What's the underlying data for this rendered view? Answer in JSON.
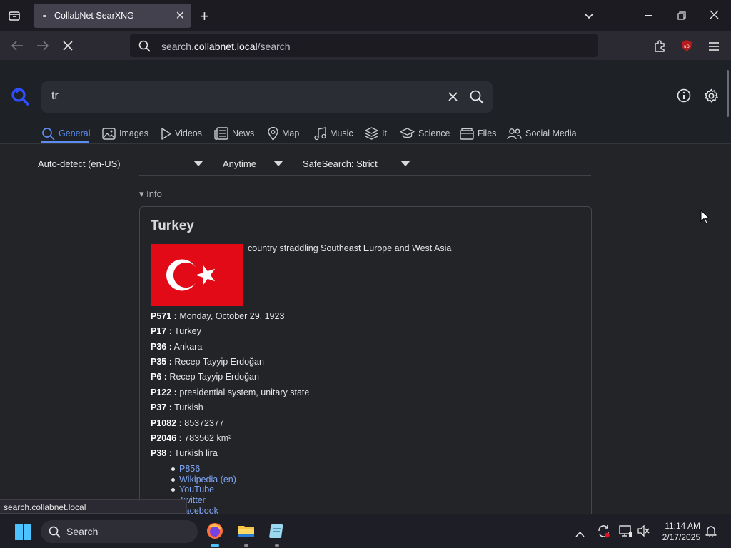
{
  "browser": {
    "tab_title": "CollabNet SearXNG",
    "url_prefix": "search.",
    "url_host": "collabnet.local",
    "url_path": "/search",
    "status_url": "search.collabnet.local"
  },
  "search": {
    "query": "tr"
  },
  "categories": [
    {
      "label": "General",
      "icon": "search-icon",
      "active": true
    },
    {
      "label": "Images",
      "icon": "image-icon"
    },
    {
      "label": "Videos",
      "icon": "play-icon"
    },
    {
      "label": "News",
      "icon": "newspaper-icon"
    },
    {
      "label": "Map",
      "icon": "map-pin-icon"
    },
    {
      "label": "Music",
      "icon": "music-note-icon"
    },
    {
      "label": "It",
      "icon": "layers-icon"
    },
    {
      "label": "Science",
      "icon": "graduation-cap-icon"
    },
    {
      "label": "Files",
      "icon": "folder-icon"
    },
    {
      "label": "Social Media",
      "icon": "people-icon"
    }
  ],
  "filters": {
    "language": "Auto-detect (en-US)",
    "time": "Anytime",
    "safesearch": "SafeSearch: Strict"
  },
  "info": {
    "toggle_label": "▾ Info",
    "title": "Turkey",
    "description": "country straddling Southeast Europe and West Asia",
    "flag_colors": {
      "red": "#e30a17",
      "white": "#ffffff"
    },
    "properties": [
      {
        "key": "P571 :",
        "value": " Monday, October 29, 1923"
      },
      {
        "key": "P17 :",
        "value": " Turkey"
      },
      {
        "key": "P36 :",
        "value": " Ankara"
      },
      {
        "key": "P35 :",
        "value": " Recep Tayyip Erdoğan"
      },
      {
        "key": "P6 :",
        "value": " Recep Tayyip Erdoğan"
      },
      {
        "key": "P122 :",
        "value": " presidential system, unitary state"
      },
      {
        "key": "P37 :",
        "value": " Turkish"
      },
      {
        "key": "P1082 :",
        "value": " 85372377"
      },
      {
        "key": "P2046 :",
        "value": " 783562 km²"
      },
      {
        "key": "P38 :",
        "value": " Turkish lira"
      }
    ],
    "links": [
      "P856",
      "Wikipedia (en)",
      "YouTube",
      "Twitter",
      "Facebook"
    ]
  },
  "taskbar": {
    "search_label": "Search",
    "time": "11:14 AM",
    "date": "2/17/2025"
  },
  "colors": {
    "accent": "#5c8cf0",
    "link": "#7fa6f5"
  }
}
